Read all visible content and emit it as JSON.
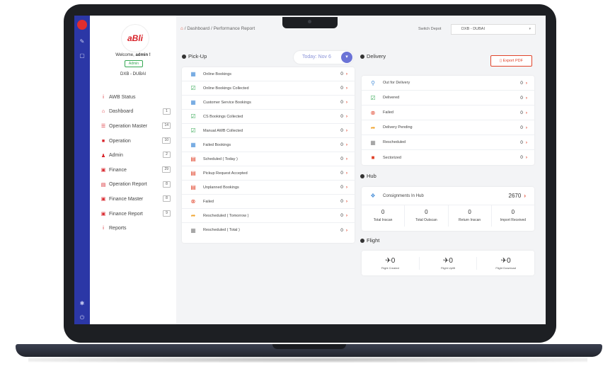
{
  "breadcrumb": {
    "home": "Dashboard",
    "current": "Performance Report"
  },
  "switch_depot": {
    "label": "Switch Depot",
    "selected": "DXB - DUBAI"
  },
  "sidebar": {
    "welcome_prefix": "Welcome,",
    "welcome_user": "admin !",
    "role": "Admin",
    "depot": "DXB - DUBAI",
    "brand": "aBli",
    "items": [
      {
        "label": "AWB Status",
        "count": ""
      },
      {
        "label": "Dashboard",
        "count": "1"
      },
      {
        "label": "Operation Master",
        "count": "14"
      },
      {
        "label": "Operation",
        "count": "10"
      },
      {
        "label": "Admin",
        "count": "2"
      },
      {
        "label": "Finance",
        "count": "29"
      },
      {
        "label": "Operation Report",
        "count": "8"
      },
      {
        "label": "Finance Master",
        "count": "8"
      },
      {
        "label": "Finance Report",
        "count": "9"
      },
      {
        "label": "Reports",
        "count": ""
      }
    ]
  },
  "pickup": {
    "title": "Pick-Up",
    "today_label": "Today: Nov 6",
    "rows": [
      {
        "label": "Online Bookings",
        "value": "0"
      },
      {
        "label": "Online Bookings Collected",
        "value": "0"
      },
      {
        "label": "Customer Service Bookings",
        "value": "0"
      },
      {
        "label": "CS Bookings Collected",
        "value": "0"
      },
      {
        "label": "Manual AWB Collected",
        "value": "0"
      },
      {
        "label": "Failed Bookings",
        "value": "0"
      },
      {
        "label": "Scheduled ( Today )",
        "value": "0"
      },
      {
        "label": "Pickup Request Accepted",
        "value": "0"
      },
      {
        "label": "Unplanned Bookings",
        "value": "0"
      },
      {
        "label": "Failed",
        "value": "0"
      },
      {
        "label": "Rescheduled ( Tomorrow )",
        "value": "0"
      },
      {
        "label": "Rescheduled ( Total )",
        "value": "0"
      }
    ]
  },
  "delivery": {
    "title": "Delivery",
    "export_label": "Export PDF",
    "rows": [
      {
        "label": "Out for Delivery",
        "value": "0"
      },
      {
        "label": "Delivered",
        "value": "0"
      },
      {
        "label": "Failed",
        "value": "0"
      },
      {
        "label": "Delivery Pending",
        "value": "0"
      },
      {
        "label": "Rescheduled",
        "value": "0"
      },
      {
        "label": "Sectorized",
        "value": "0"
      }
    ]
  },
  "hub": {
    "title": "Hub",
    "label": "Consignments In Hub",
    "value": "2670",
    "stats": [
      {
        "label": "Total Inscan",
        "value": "0"
      },
      {
        "label": "Total Outscan",
        "value": "0"
      },
      {
        "label": "Return Inscan",
        "value": "0"
      },
      {
        "label": "Import Received",
        "value": "0"
      }
    ]
  },
  "flight": {
    "title": "Flight",
    "stats": [
      {
        "label": "Flight Created",
        "value": "0"
      },
      {
        "label": "Flight Uplift",
        "value": "0"
      },
      {
        "label": "Flight Download",
        "value": "0"
      }
    ]
  }
}
